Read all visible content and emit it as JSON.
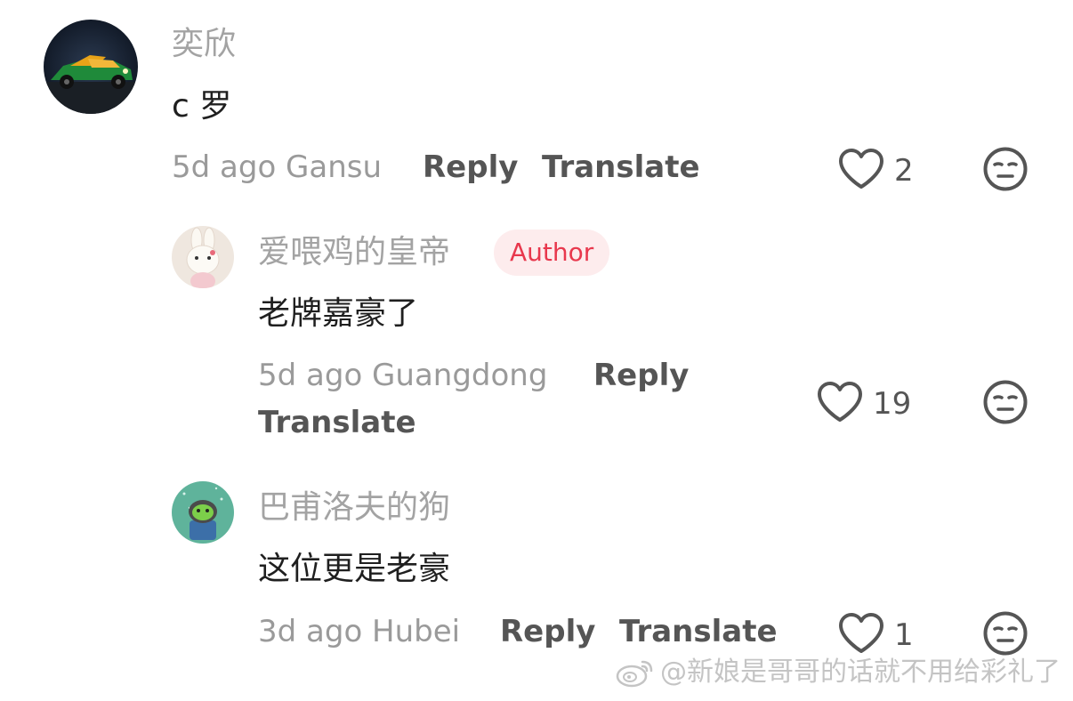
{
  "comments": [
    {
      "username": "奕欣",
      "text": "c 罗",
      "meta": "5d ago Gansu",
      "reply_label": "Reply",
      "translate_label": "Translate",
      "likes": "2"
    },
    {
      "username": "爱喂鸡的皇帝",
      "badge": "Author",
      "text": "老牌嘉豪了",
      "meta": "5d ago Guangdong",
      "reply_label": "Reply",
      "translate_label": "Translate",
      "likes": "19"
    },
    {
      "username": "巴甫洛夫的狗",
      "text": "这位更是老豪",
      "meta": "3d ago Hubei",
      "reply_label": "Reply",
      "translate_label": "Translate",
      "likes": "1"
    }
  ],
  "watermark": {
    "text": "@新娘是哥哥的话就不用给彩礼了"
  },
  "colors": {
    "username": "#a3a3a3",
    "author_badge_bg": "#fdeced",
    "author_badge_text": "#e8384d",
    "action": "#555555",
    "meta": "#9a9a9a"
  },
  "icons": {
    "like": "heart-outline-icon",
    "dislike": "unamused-face-icon",
    "watermark": "weibo-logo-icon"
  }
}
